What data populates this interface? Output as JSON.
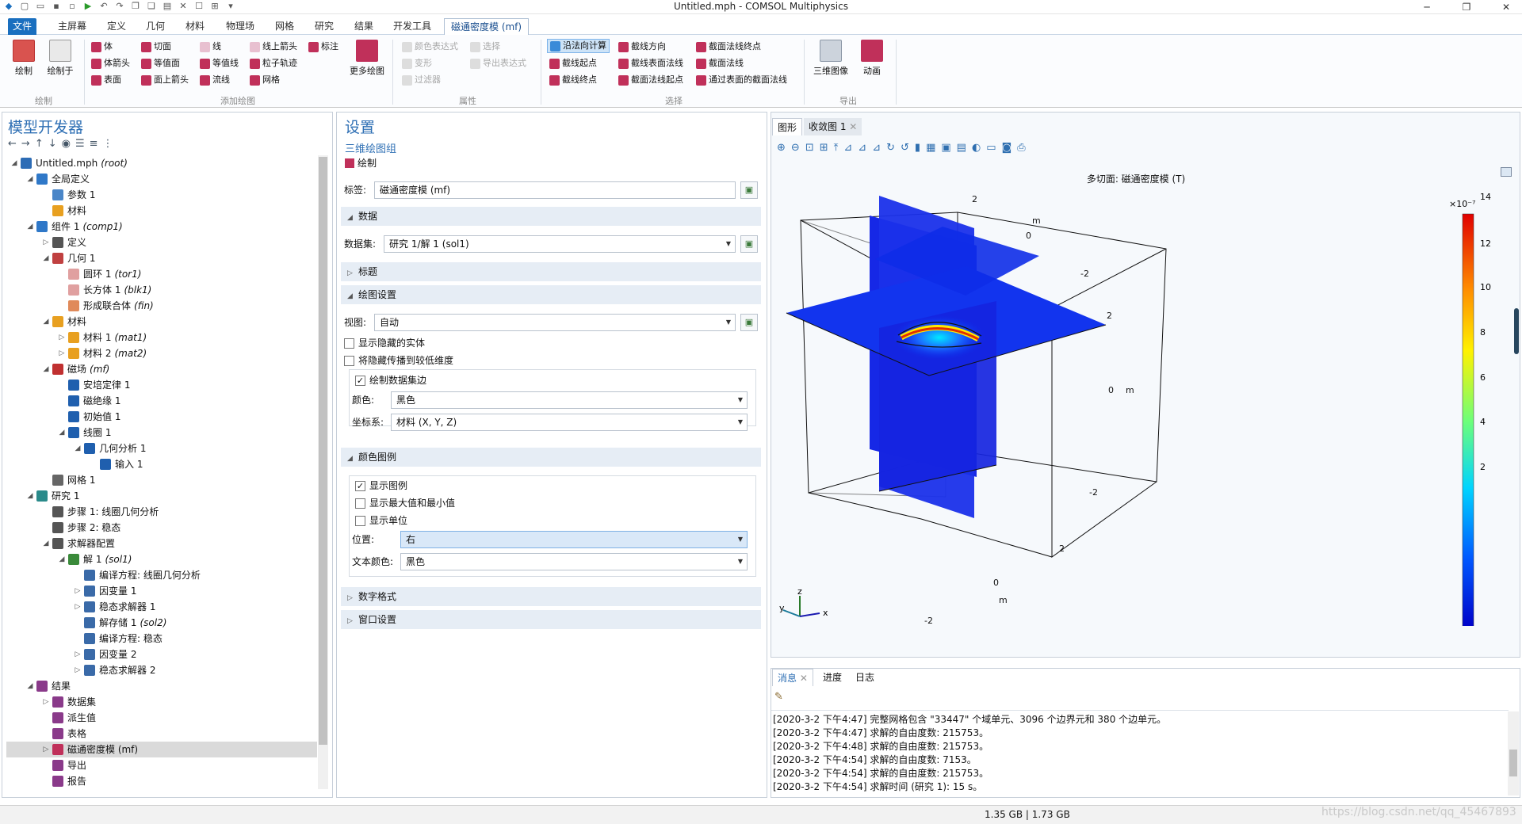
{
  "window": {
    "title": "Untitled.mph - COMSOL Multiphysics"
  },
  "ribbon_tabs": [
    "文件",
    "主屏幕",
    "定义",
    "几何",
    "材料",
    "物理场",
    "网格",
    "研究",
    "结果",
    "开发工具",
    "磁通密度模 (mf)"
  ],
  "ribbon": {
    "groups": {
      "draw": "绘制",
      "add_plot": "添加绘图",
      "attributes": "属性",
      "select": "选择",
      "export": "导出"
    },
    "draw_btn": "绘制",
    "draw_into_btn": "绘制于",
    "plots": [
      "体",
      "切面",
      "线",
      "线上箭头",
      "标注",
      "体箭头",
      "等值面",
      "等值线",
      "粒子轨迹",
      "表面",
      "面上箭头",
      "流线",
      "网格"
    ],
    "more_plots": "更多绘图",
    "attrs": [
      "颜色表达式",
      "选择",
      "变形",
      "导出表达式",
      "过滤器"
    ],
    "select_items": [
      "沿法向计算",
      "截线方向",
      "截面法线终点",
      "截线起点",
      "截线表面法线",
      "截面法线",
      "截线终点",
      "截面法线起点",
      "通过表面的截面法线"
    ],
    "image_3d": "三维图像",
    "animation": "动画"
  },
  "model_builder": {
    "title": "模型开发器",
    "tree": [
      {
        "label": "Untitled.mph",
        "tag": "(root)",
        "level": 0,
        "toggle": "◢",
        "icon_color": "#2d6cb5"
      },
      {
        "label": "全局定义",
        "tag": "",
        "level": 1,
        "toggle": "◢",
        "icon_color": "#2f78c8"
      },
      {
        "label": "参数 1",
        "tag": "",
        "level": 2,
        "toggle": "",
        "icon_color": "#4a86c8"
      },
      {
        "label": "材料",
        "tag": "",
        "level": 2,
        "toggle": "",
        "icon_color": "#e8a020"
      },
      {
        "label": "组件 1",
        "tag": "(comp1)",
        "level": 1,
        "toggle": "◢",
        "icon_color": "#2f78c8"
      },
      {
        "label": "定义",
        "tag": "",
        "level": 2,
        "toggle": "▷",
        "icon_color": "#555"
      },
      {
        "label": "几何 1",
        "tag": "",
        "level": 2,
        "toggle": "◢",
        "icon_color": "#c04040"
      },
      {
        "label": "圆环 1",
        "tag": "(tor1)",
        "level": 3,
        "toggle": "",
        "icon_color": "#e0a0a0"
      },
      {
        "label": "长方体 1",
        "tag": "(blk1)",
        "level": 3,
        "toggle": "",
        "icon_color": "#e0a0a0"
      },
      {
        "label": "形成联合体",
        "tag": "(fin)",
        "level": 3,
        "toggle": "",
        "icon_color": "#e08a5a"
      },
      {
        "label": "材料",
        "tag": "",
        "level": 2,
        "toggle": "◢",
        "icon_color": "#e8a020"
      },
      {
        "label": "材料 1",
        "tag": "(mat1)",
        "level": 3,
        "toggle": "▷",
        "icon_color": "#e8a020"
      },
      {
        "label": "材料 2",
        "tag": "(mat2)",
        "level": 3,
        "toggle": "▷",
        "icon_color": "#e8a020"
      },
      {
        "label": "磁场",
        "tag": "(mf)",
        "level": 2,
        "toggle": "◢",
        "icon_color": "#c03030"
      },
      {
        "label": "安培定律 1",
        "tag": "",
        "level": 3,
        "toggle": "",
        "icon_color": "#1f5fae"
      },
      {
        "label": "磁绝缘 1",
        "tag": "",
        "level": 3,
        "toggle": "",
        "icon_color": "#1f5fae"
      },
      {
        "label": "初始值 1",
        "tag": "",
        "level": 3,
        "toggle": "",
        "icon_color": "#1f5fae"
      },
      {
        "label": "线圈 1",
        "tag": "",
        "level": 3,
        "toggle": "◢",
        "icon_color": "#1f5fae"
      },
      {
        "label": "几何分析 1",
        "tag": "",
        "level": 4,
        "toggle": "◢",
        "icon_color": "#1f5fae"
      },
      {
        "label": "输入 1",
        "tag": "",
        "level": 5,
        "toggle": "",
        "icon_color": "#1f5fae"
      },
      {
        "label": "网格 1",
        "tag": "",
        "level": 2,
        "toggle": "",
        "icon_color": "#666"
      },
      {
        "label": "研究 1",
        "tag": "",
        "level": 1,
        "toggle": "◢",
        "icon_color": "#2a8a8a"
      },
      {
        "label": "步骤 1: 线圈几何分析",
        "tag": "",
        "level": 2,
        "toggle": "",
        "icon_color": "#555"
      },
      {
        "label": "步骤 2: 稳态",
        "tag": "",
        "level": 2,
        "toggle": "",
        "icon_color": "#555"
      },
      {
        "label": "求解器配置",
        "tag": "",
        "level": 2,
        "toggle": "◢",
        "icon_color": "#555"
      },
      {
        "label": "解 1",
        "tag": "(sol1)",
        "level": 3,
        "toggle": "◢",
        "icon_color": "#3a8a3a"
      },
      {
        "label": "编译方程: 线圈几何分析",
        "tag": "",
        "level": 4,
        "toggle": "",
        "icon_color": "#3a6aa8"
      },
      {
        "label": "因变量 1",
        "tag": "",
        "level": 4,
        "toggle": "▷",
        "icon_color": "#3a6aa8"
      },
      {
        "label": "稳态求解器 1",
        "tag": "",
        "level": 4,
        "toggle": "▷",
        "icon_color": "#3a6aa8"
      },
      {
        "label": "解存储 1",
        "tag": "(sol2)",
        "level": 4,
        "toggle": "",
        "icon_color": "#3a6aa8"
      },
      {
        "label": "编译方程: 稳态",
        "tag": "",
        "level": 4,
        "toggle": "",
        "icon_color": "#3a6aa8"
      },
      {
        "label": "因变量 2",
        "tag": "",
        "level": 4,
        "toggle": "▷",
        "icon_color": "#3a6aa8"
      },
      {
        "label": "稳态求解器 2",
        "tag": "",
        "level": 4,
        "toggle": "▷",
        "icon_color": "#3a6aa8"
      },
      {
        "label": "结果",
        "tag": "",
        "level": 1,
        "toggle": "◢",
        "icon_color": "#8a3a8a"
      },
      {
        "label": "数据集",
        "tag": "",
        "level": 2,
        "toggle": "▷",
        "icon_color": "#8a3a8a"
      },
      {
        "label": "派生值",
        "tag": "",
        "level": 2,
        "toggle": "",
        "icon_color": "#8a3a8a"
      },
      {
        "label": "表格",
        "tag": "",
        "level": 2,
        "toggle": "",
        "icon_color": "#8a3a8a"
      },
      {
        "label": "磁通密度模 (mf)",
        "tag": "",
        "level": 2,
        "toggle": "▷",
        "icon_color": "#c0305a",
        "selected": true
      },
      {
        "label": "导出",
        "tag": "",
        "level": 2,
        "toggle": "",
        "icon_color": "#8a3a8a"
      },
      {
        "label": "报告",
        "tag": "",
        "level": 2,
        "toggle": "",
        "icon_color": "#8a3a8a"
      }
    ]
  },
  "settings": {
    "title": "设置",
    "subtitle": "三维绘图组",
    "draw_link": "绘制",
    "label_caption": "标签:",
    "label_value": "磁通密度模 (mf)",
    "sec_data": "数据",
    "dataset_caption": "数据集:",
    "dataset_value": "研究 1/解 1 (sol1)",
    "sec_title": "标题",
    "sec_plot": "绘图设置",
    "view_caption": "视图:",
    "view_value": "自动",
    "cb_hidden": "显示隐藏的实体",
    "cb_propagate": "将隐藏传播到较低维度",
    "cb_edges": "绘制数据集边",
    "color_caption": "颜色:",
    "color_value": "黑色",
    "coord_caption": "坐标系:",
    "coord_value": "材料 (X, Y, Z)",
    "sec_legend": "颜色图例",
    "cb_show_legend": "显示图例",
    "cb_maxmin": "显示最大值和最小值",
    "cb_units": "显示单位",
    "position_caption": "位置:",
    "position_value": "右",
    "textcolor_caption": "文本颜色:",
    "textcolor_value": "黑色",
    "sec_number": "数字格式",
    "sec_window": "窗口设置"
  },
  "graphics": {
    "tab_graphics": "图形",
    "tab_convergence": "收敛图 1",
    "plot_title": "多切面: 磁通密度模 (T)",
    "colorbar_exp": "×10⁻⁷",
    "colorbar_ticks": [
      "14",
      "12",
      "10",
      "8",
      "6",
      "4",
      "2"
    ],
    "axis_labels": [
      "2",
      "m",
      "0",
      "-2",
      "2",
      "0",
      "m",
      "-2",
      "2",
      "0",
      "m",
      "-2"
    ],
    "triad": [
      "z",
      "y",
      "x"
    ]
  },
  "messages": {
    "tabs": [
      "消息",
      "进度",
      "日志"
    ],
    "lines": [
      "[2020-3-2 下午4:47] 完整网格包含 \"33447\" 个域单元、3096 个边界元和 380 个边单元。",
      "[2020-3-2 下午4:47] 求解的自由度数: 215753。",
      "[2020-3-2 下午4:48] 求解的自由度数: 215753。",
      "[2020-3-2 下午4:54] 求解的自由度数: 7153。",
      "[2020-3-2 下午4:54] 求解的自由度数: 215753。",
      "[2020-3-2 下午4:54] 求解时间 (研究 1): 15 s。"
    ]
  },
  "status": {
    "memory": "1.35 GB | 1.73 GB",
    "watermark": "https://blog.csdn.net/qq_45467893"
  }
}
